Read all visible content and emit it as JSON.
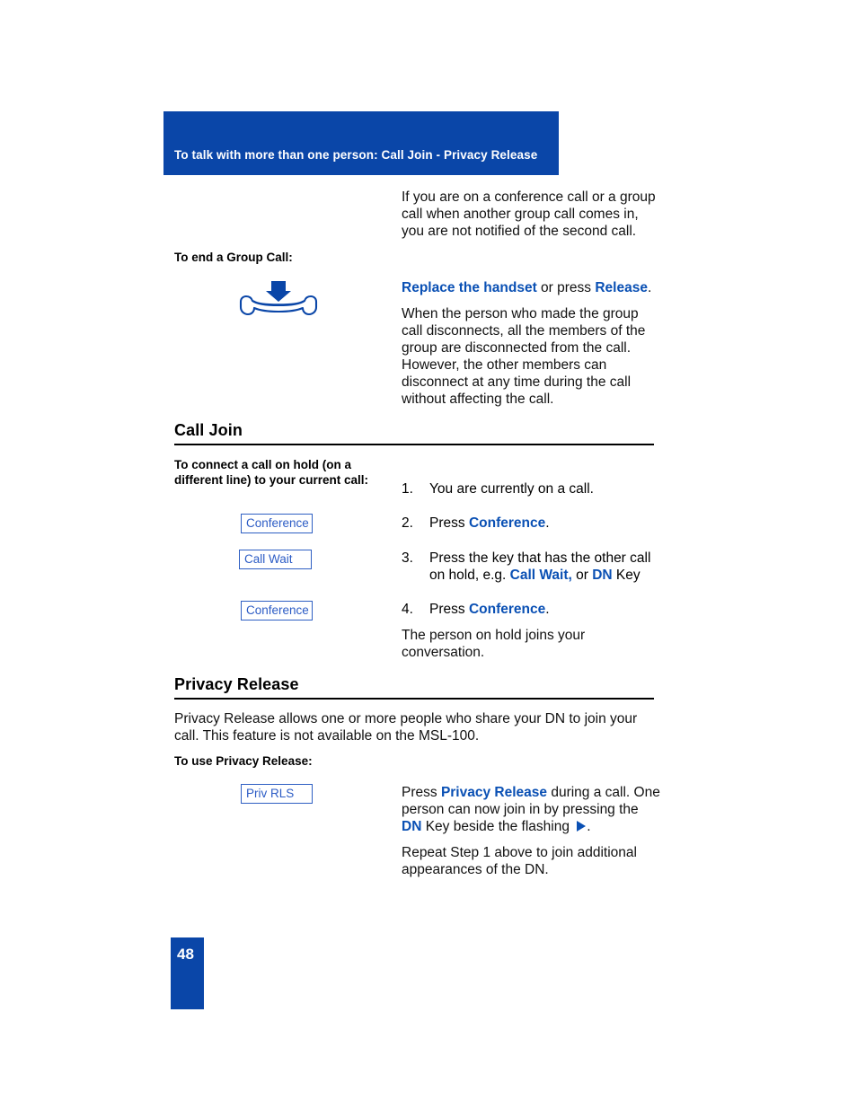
{
  "header": {
    "title": "To talk with more than one person: Call Join - Privacy Release",
    "bg_color": "#0A46A8"
  },
  "intro": {
    "paragraph": "If you are on a conference call or a group call when another group call comes in, you are not notified of the second call."
  },
  "end_group_call": {
    "label": "To end a Group Call:",
    "icon_name": "replace-handset-icon",
    "action_line": {
      "emphasis_1": "Replace the handset",
      "middle": " or press ",
      "emphasis_2": "Release",
      "trailing": "."
    },
    "paragraph": "When the person who made the group call disconnects, all the members of the group are disconnected from the call. However, the other members can disconnect at any time during the call without affecting the call."
  },
  "call_join": {
    "heading": "Call Join",
    "label": "To connect a call on hold (on a different line) to your current call:",
    "keys": {
      "conference_1": "Conference",
      "call_wait": "Call Wait",
      "conference_2": "Conference"
    },
    "steps": [
      {
        "num": "1.",
        "text": "You are currently on a call."
      },
      {
        "num": "2.",
        "pre": "Press ",
        "em": "Conference",
        "post": "."
      },
      {
        "num": "3.",
        "pre": "Press the key that has the other call on hold, e.g. ",
        "em": "Call Wait,",
        "mid": " or ",
        "em2": "DN",
        "post": " Key"
      },
      {
        "num": "4.",
        "pre": "Press ",
        "em": "Conference",
        "post": "."
      }
    ],
    "closing": "The person on hold joins your conversation."
  },
  "privacy_release": {
    "heading": "Privacy Release",
    "paragraph": "Privacy Release allows one or more people who share your DN to join your call. This feature is not available on the MSL-100.",
    "label": "To use Privacy Release:",
    "key": "Priv RLS",
    "instruction": {
      "pre": "Press ",
      "em": "Privacy Release",
      "mid": " during a call. One person can now join in by pressing the ",
      "em2": "DN",
      "post": " Key beside the flashing ",
      "end": "."
    },
    "repeat": "Repeat Step 1 above to join additional appearances of the DN."
  },
  "footer": {
    "page_number": "48",
    "bg_color": "#0A46A8"
  },
  "colors": {
    "brand_blue": "#0A46A8",
    "link_blue": "#0A50B4",
    "key_border": "#2E5FC3",
    "key_text": "#2C5CC5"
  }
}
